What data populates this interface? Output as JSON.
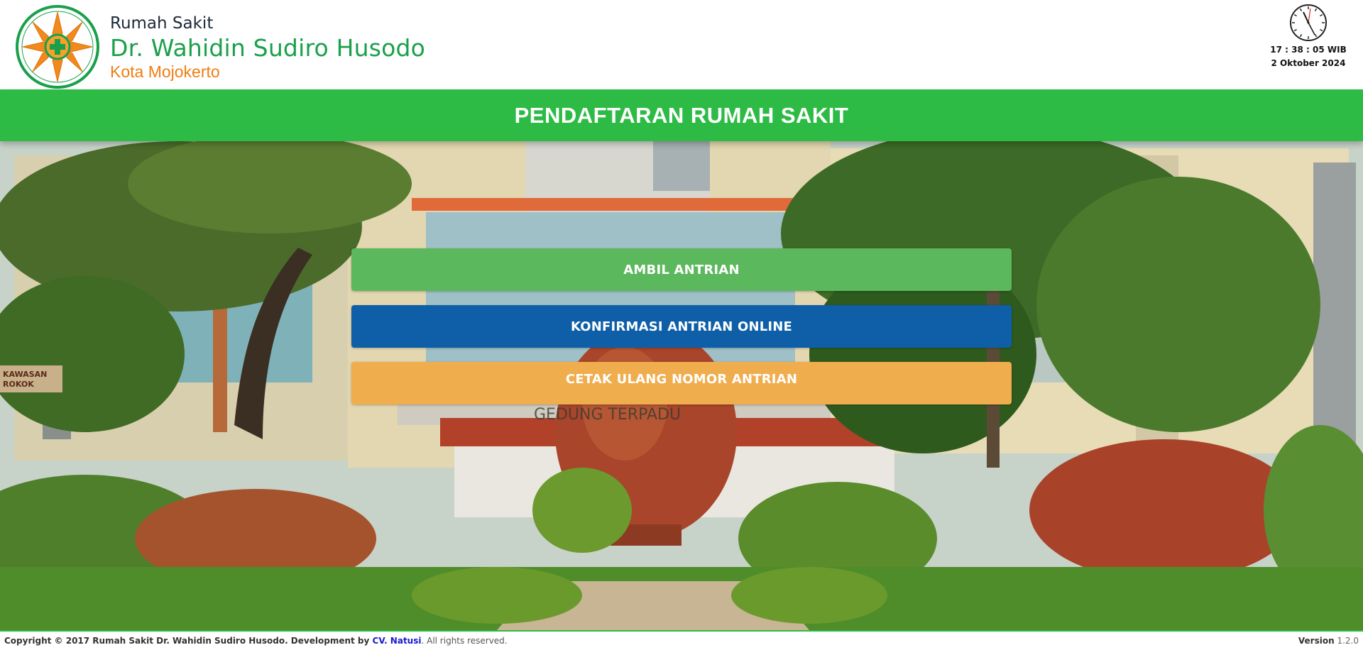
{
  "header": {
    "brand_line1": "Rumah Sakit",
    "brand_line2": "Dr. Wahidin Sudiro Husodo",
    "brand_line3": "Kota Mojokerto",
    "logo_icon": "hospital-emblem-icon",
    "clock_icon": "analog-clock-icon",
    "time": "17 : 38 : 05 WIB",
    "date": "2 Oktober 2024"
  },
  "title_bar": {
    "title": "PENDAFTARAN RUMAH SAKIT"
  },
  "menu": {
    "take_queue": "AMBIL ANTRIAN",
    "confirm_online": "KONFIRMASI ANTRIAN ONLINE",
    "reprint": "CETAK ULANG NOMOR ANTRIAN"
  },
  "background": {
    "sign_text": "GEDUNG TERPADU",
    "left_sign": "KAWASAN ROKOK"
  },
  "footer": {
    "copyright": "Copyright © 2017 Rumah Sakit Dr. Wahidin Sudiro Husodo. Development by ",
    "developer": "CV. Natusi",
    "rights": ". All rights reserved.",
    "version_label": "Version",
    "version_number": "1.2.0"
  },
  "colors": {
    "brand_green": "#1aa04a",
    "title_bar_green": "#2dbb45",
    "brand_orange": "#f07d12",
    "button_green": "#5cb85c",
    "button_blue": "#0e5fa7",
    "button_orange": "#f0ad4e"
  }
}
